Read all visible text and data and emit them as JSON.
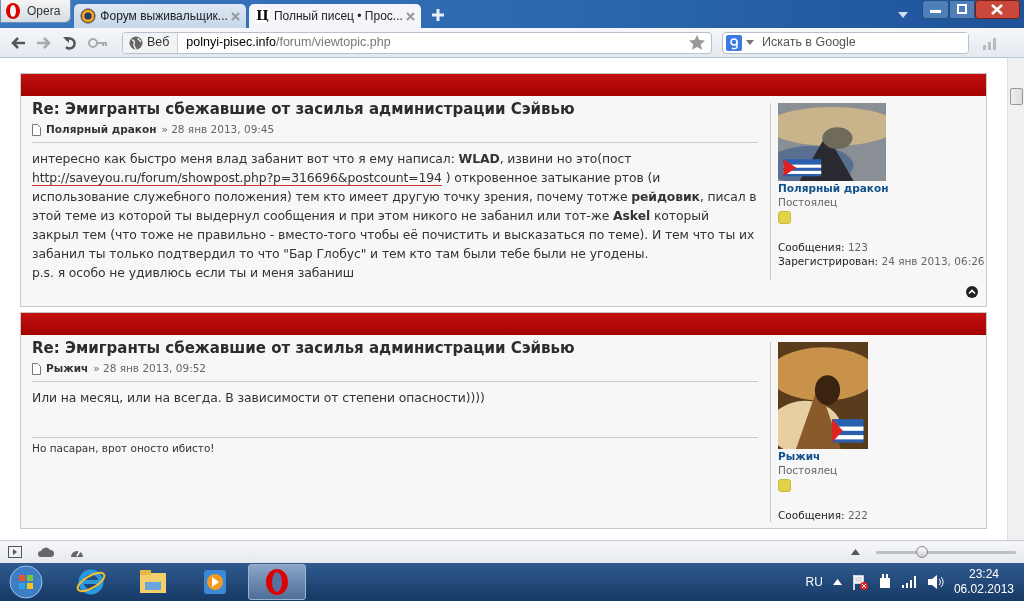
{
  "browser": {
    "menu_label": "Opera",
    "tabs": [
      {
        "label": "Форум выживальщик...",
        "selected": false
      },
      {
        "label": "Полный писец • Прос...",
        "selected": true,
        "favicon_text": "Ц"
      }
    ],
    "address": {
      "mode_label": "Веб",
      "host": "polnyi-pisec.info",
      "path": "/forum/viewtopic.php"
    },
    "search": {
      "placeholder": "Искать в Google"
    }
  },
  "posts": [
    {
      "title": "Re: Эмигранты сбежавшие от засилья администрации Сэйвью",
      "author": "Полярный дракон",
      "date": "» 28 янв 2013, 09:45",
      "body": [
        {
          "kind": "text",
          "text": "интересно как быстро меня влад забанит вот что я ему написал: **WLAD**, извини но это(пост "
        },
        {
          "kind": "link",
          "text": "http://saveyou.ru/forum/showpost.php?p=316696&postcount=194"
        },
        {
          "kind": "text",
          "text": " ) откровенное затыкание ртов (и использование служебного положения) тем кто имеет другую точку зрения, почему тотже **рейдовик**, писал в этой теме из которой ты выдернул сообщения и при этом никого не забанил или тот-же **Askel** который закрыл тем (что тоже не правильно - вместо-того чтобы её почистить и высказаться по теме). И тем что ты их забанил ты только подтвердил то что \"Бар Глобус\" и тем кто там были тебе были не угодены."
        },
        {
          "kind": "break"
        },
        {
          "kind": "text",
          "text": "p.s. я особо не удивлюсь если ты и меня забаниш"
        }
      ],
      "back_to_top": true,
      "profile": {
        "name": "Полярный дракон",
        "rank": "Постоялец",
        "stats": [
          {
            "label": "Сообщения:",
            "value": "123"
          },
          {
            "label": "Зарегистрирован:",
            "value": "24 янв 2013, 06:26"
          }
        ]
      }
    },
    {
      "title": "Re: Эмигранты сбежавшие от засилья администрации Сэйвью",
      "author": "Рыжич",
      "date": "» 28 янв 2013, 09:52",
      "body": [
        {
          "kind": "text",
          "text": "Или на месяц, или на всегда. В зависимости от степени опасности))))"
        }
      ],
      "signature": "Но пасаран, врот оносто ибисто!",
      "back_to_top": false,
      "profile": {
        "name": "Рыжич",
        "rank": "Постоялец",
        "stats": [
          {
            "label": "Сообщения:",
            "value": "222"
          }
        ]
      }
    }
  ],
  "status_bar": {
    "zoom": {
      "level": 0.33
    }
  },
  "taskbar": {
    "apps": [
      {
        "selected": false
      },
      {
        "selected": false
      },
      {
        "selected": false
      },
      {
        "selected": true
      }
    ],
    "language": "RU",
    "time": "23:24",
    "date": "06.02.2013"
  }
}
